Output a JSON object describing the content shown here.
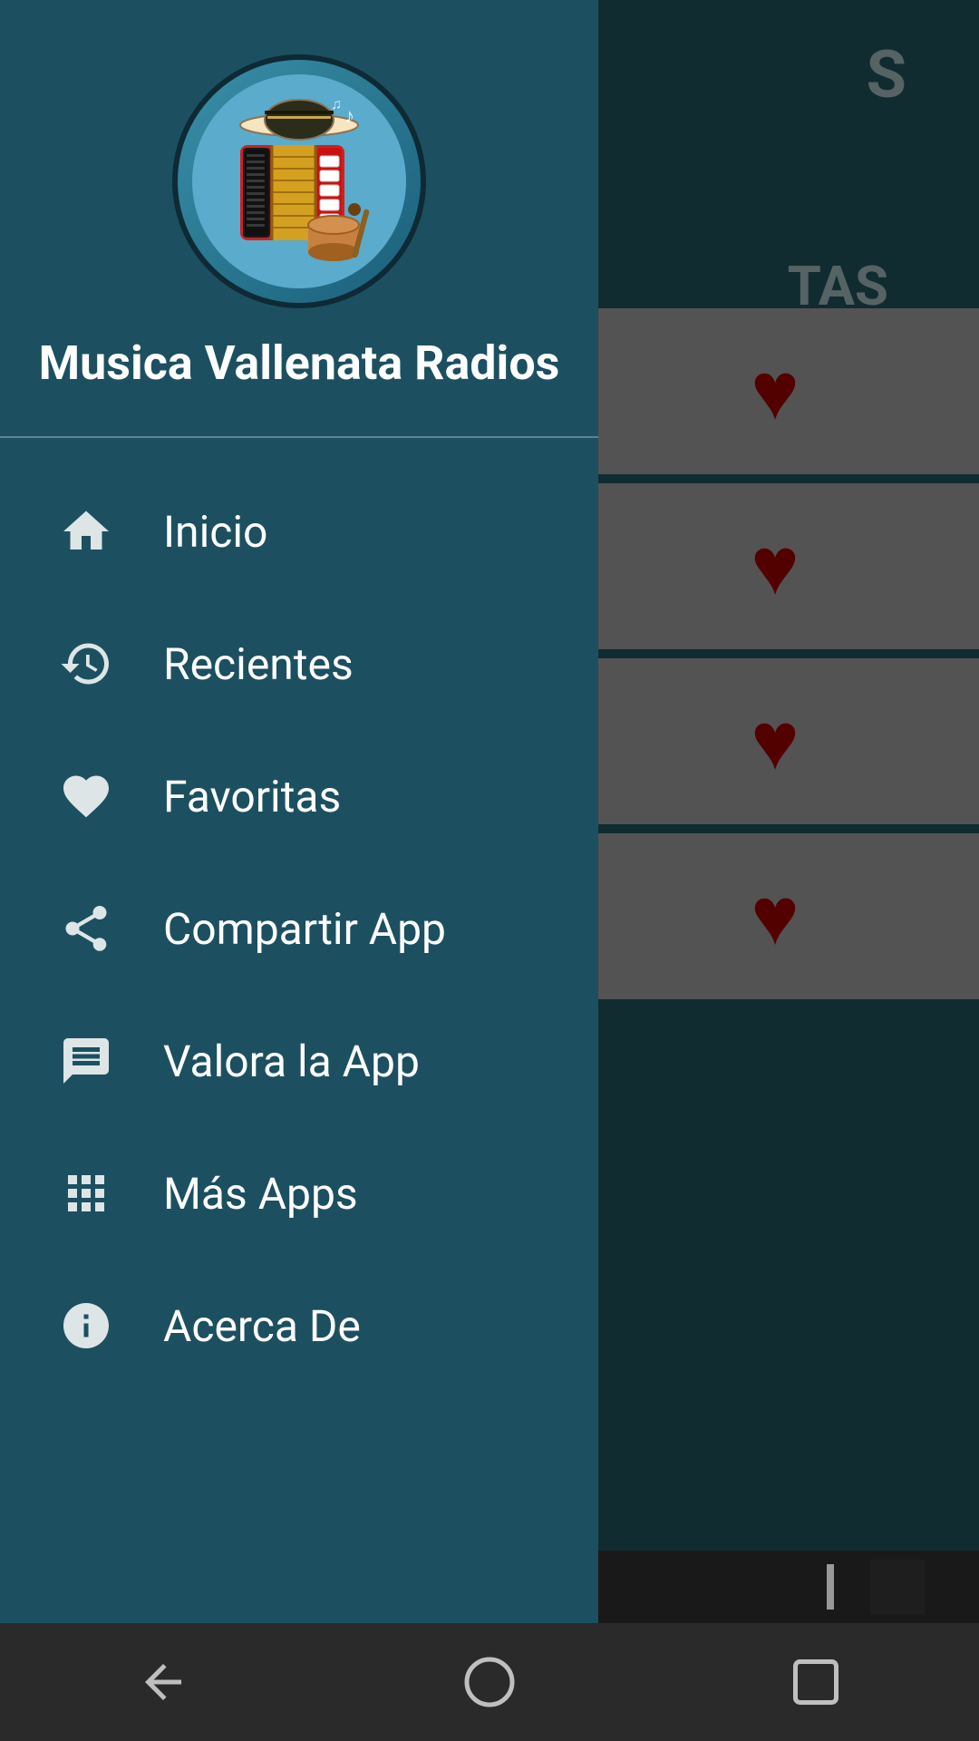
{
  "app": {
    "title": "Musica Vallenata Radios",
    "logo_alt": "Accordion and drum instrument logo"
  },
  "background": {
    "partial_title_s": "S",
    "favoritas_label": "TAS"
  },
  "drawer": {
    "header": {
      "title": "Musica Vallenata Radios"
    },
    "menu_items": [
      {
        "id": "inicio",
        "label": "Inicio",
        "icon": "home-icon"
      },
      {
        "id": "recientes",
        "label": "Recientes",
        "icon": "history-icon"
      },
      {
        "id": "favoritas",
        "label": "Favoritas",
        "icon": "heart-icon"
      },
      {
        "id": "compartir",
        "label": "Compartir App",
        "icon": "share-icon"
      },
      {
        "id": "valora",
        "label": "Valora la App",
        "icon": "rate-icon"
      },
      {
        "id": "mas-apps",
        "label": "Más Apps",
        "icon": "apps-icon"
      },
      {
        "id": "acerca",
        "label": "Acerca De",
        "icon": "info-icon"
      }
    ]
  },
  "radio_list": {
    "items": [
      {
        "id": 1,
        "has_heart": true
      },
      {
        "id": 2,
        "has_heart": true
      },
      {
        "id": 3,
        "has_heart": true
      },
      {
        "id": 4,
        "has_heart": true
      }
    ]
  },
  "nav_bar": {
    "back_label": "Back",
    "home_label": "Home",
    "recents_label": "Recents"
  }
}
